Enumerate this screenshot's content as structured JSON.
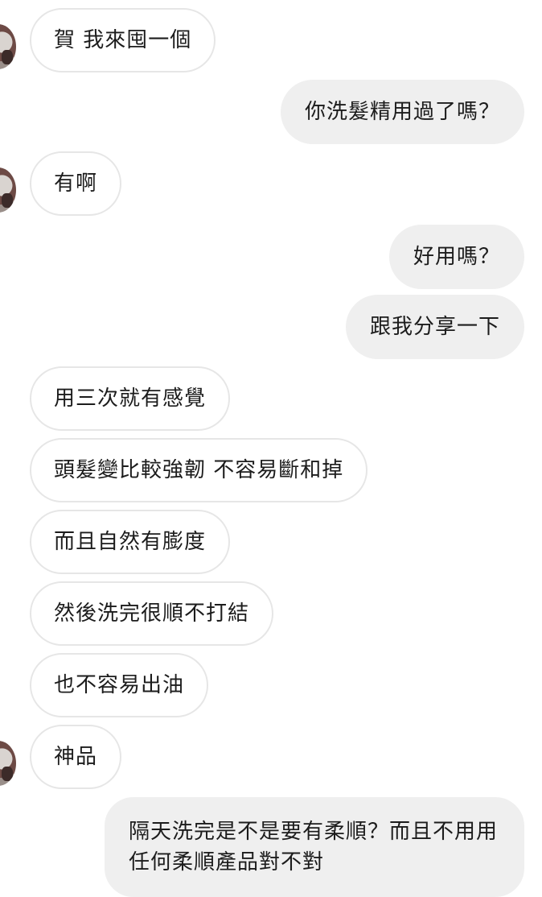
{
  "conversation": {
    "messages": [
      {
        "direction": "in",
        "text": "賀 我來囤一個"
      },
      {
        "direction": "out",
        "text": "你洗髮精用過了嗎？"
      },
      {
        "direction": "in",
        "text": "有啊"
      },
      {
        "direction": "out",
        "text": "好用嗎？"
      },
      {
        "direction": "out",
        "text": "跟我分享一下"
      },
      {
        "direction": "in",
        "text": "用三次就有感覺"
      },
      {
        "direction": "in",
        "text": "頭髮變比較強韌 不容易斷和掉"
      },
      {
        "direction": "in",
        "text": "而且自然有膨度"
      },
      {
        "direction": "in",
        "text": "然後洗完很順不打結"
      },
      {
        "direction": "in",
        "text": "也不容易出油"
      },
      {
        "direction": "in",
        "text": "神品"
      },
      {
        "direction": "out",
        "text": "隔天洗完是不是要有柔順？而且不用用任何柔順產品對不對"
      }
    ]
  }
}
